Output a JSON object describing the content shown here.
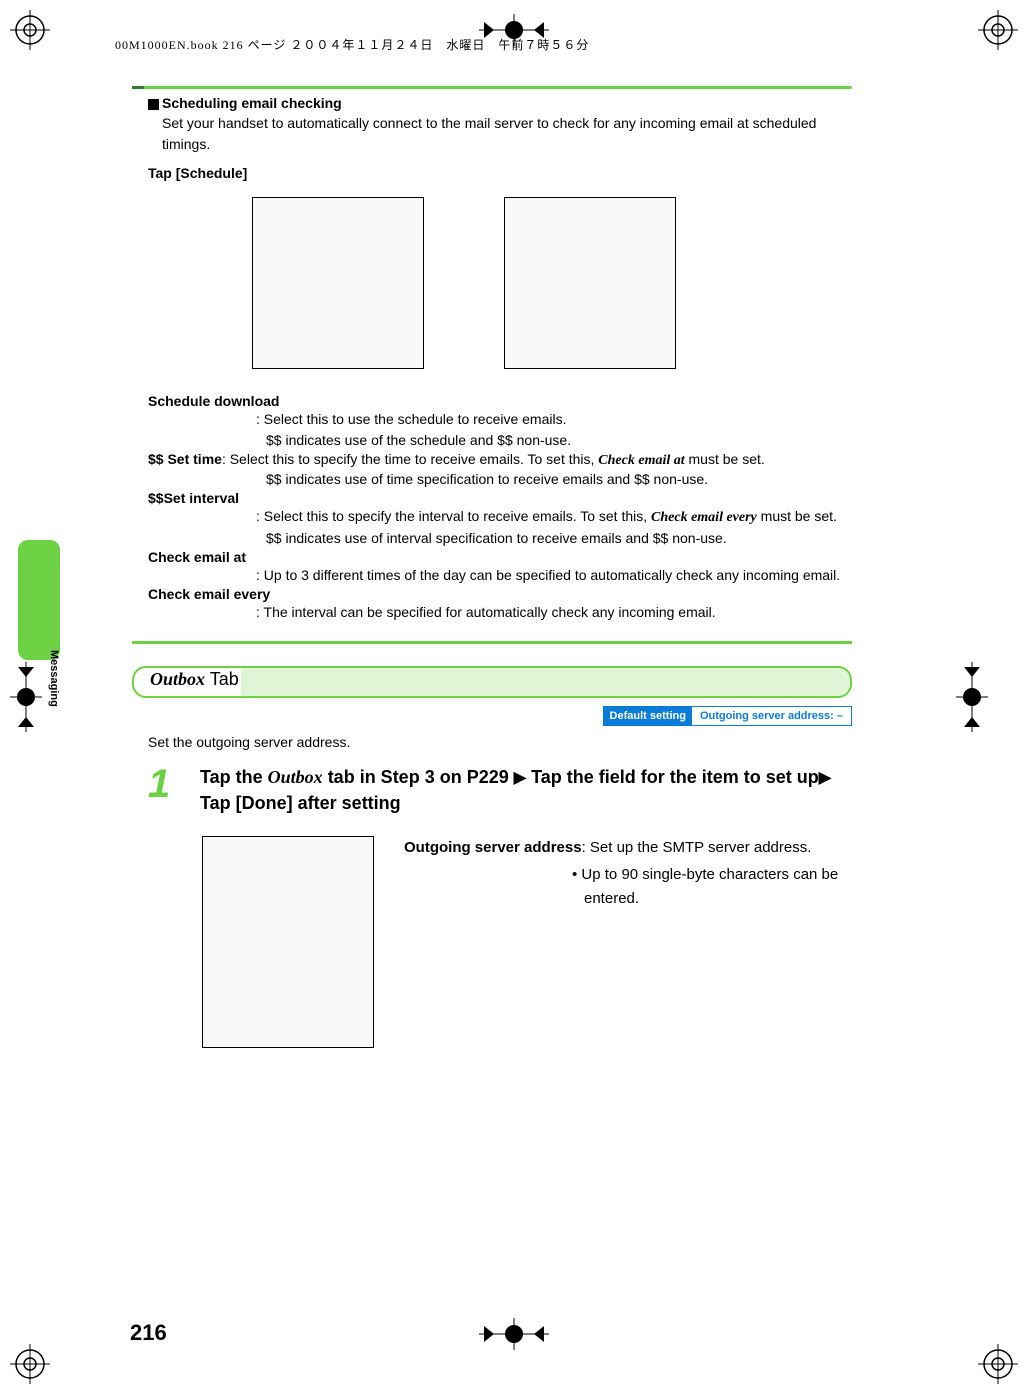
{
  "header_line": "00M1000EN.book  216 ページ  ２００４年１１月２４日　水曜日　午前７時５６分",
  "section": {
    "title": "Scheduling email checking",
    "desc": "Set your handset to automatically connect to the mail server to check for any incoming email at scheduled timings.",
    "tap": "Tap [Schedule]"
  },
  "defs": {
    "schedule_download": {
      "term": "Schedule download",
      "desc1": ": Select this to use the schedule to receive emails.",
      "desc2": "$$ indicates use of the schedule and $$ non-use."
    },
    "set_time": {
      "term": "$$ Set time",
      "desc1a": ": Select this to specify the time to receive emails. To set this, ",
      "desc1b": "Check email at",
      "desc1c": " must be set.",
      "desc2": "$$ indicates use of time specification to receive emails and $$ non-use."
    },
    "set_interval": {
      "term": "$$Set interval",
      "desc1a": ": Select this to specify the interval to receive emails. To set this, ",
      "desc1b": "Check email every",
      "desc1c": " must be set.",
      "desc2": "$$ indicates use of interval specification to receive emails and $$ non-use."
    },
    "check_at": {
      "term": "Check email at",
      "desc1": ": Up to 3 different times of the day can be specified to automatically check any incoming email."
    },
    "check_every": {
      "term": "Check email every",
      "desc1": ": The interval can be specified for automatically check any incoming email."
    }
  },
  "outbox": {
    "heading_it": "Outbox",
    "heading_txt": " Tab",
    "default_label": "Default setting",
    "default_value": "Outgoing server address: –",
    "set_line": "Set the outgoing server address.",
    "step_num": "1",
    "step_a": "Tap the ",
    "step_b": "Outbox",
    "step_c": " tab in Step 3 on P229 ",
    "step_d": " Tap the field for the item to set up",
    "step_e": " Tap [Done] after setting",
    "out_term": "Outgoing server address",
    "out_def1": ": Set up the SMTP server address.",
    "out_def2": "• Up to 90 single-byte characters can be entered."
  },
  "sidebar_label": "Messaging",
  "page_number": "216"
}
